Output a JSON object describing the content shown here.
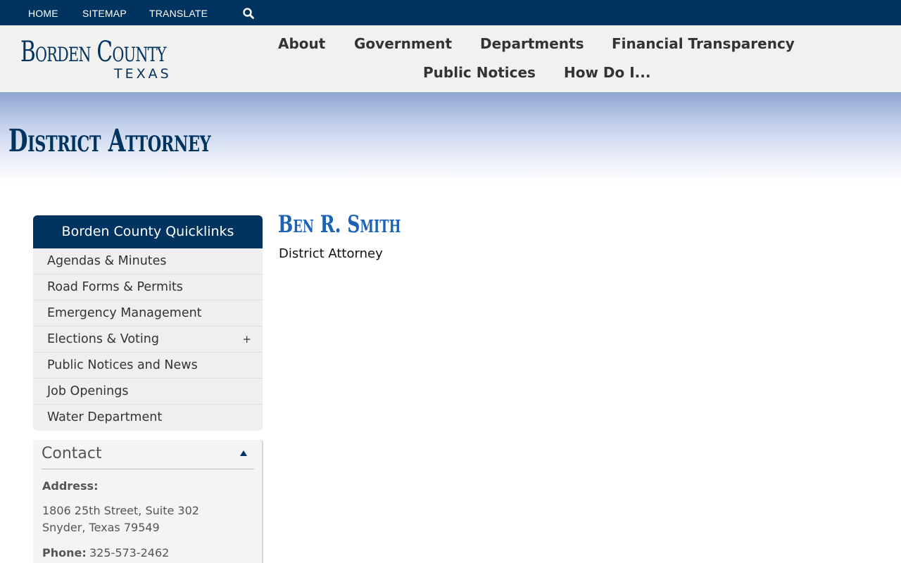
{
  "topbar": {
    "links": [
      "HOME",
      "SITEMAP",
      "TRANSLATE"
    ],
    "search_icon": "search-icon"
  },
  "header": {
    "logo_name": "Borden County",
    "logo_state": "TEXAS",
    "nav": [
      "About",
      "Government",
      "Departments",
      "Financial Transparency",
      "Public Notices",
      "How Do I..."
    ]
  },
  "banner": {
    "title": "District Attorney"
  },
  "quicklinks": {
    "title": "Borden County Quicklinks",
    "items": [
      "Agendas & Minutes",
      "Road Forms & Permits",
      "Emergency Management",
      "Elections & Voting",
      "Public Notices and News",
      "Job Openings",
      "Water Department"
    ],
    "expand_symbol": "+"
  },
  "contact": {
    "title": "Contact",
    "address_label": "Address:",
    "address_line1": "1806 25th Street, Suite 302",
    "address_line2": "Snyder, Texas 79549",
    "phone_label": "Phone:",
    "phone": "325-573-2462"
  },
  "main": {
    "name": "Ben R. Smith",
    "role": "District Attorney"
  },
  "colors": {
    "navy": "#00335f",
    "link_blue": "#1e63b3",
    "header_bg": "#f1f1ef"
  }
}
